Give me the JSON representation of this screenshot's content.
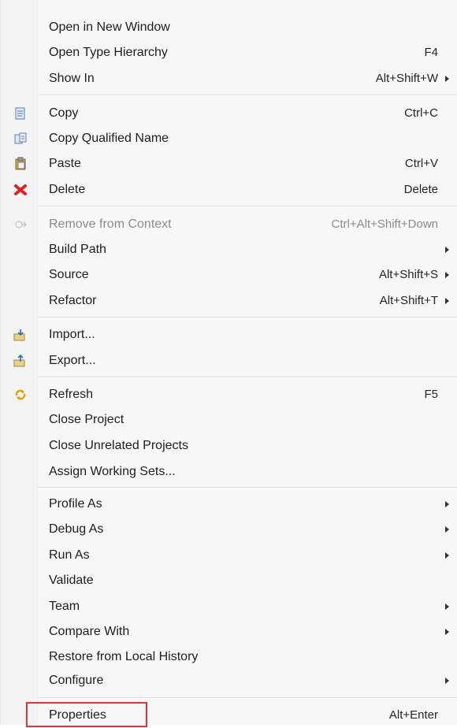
{
  "menu": {
    "groups": [
      {
        "items": [
          {
            "label": "Open in New Window",
            "shortcut": ""
          },
          {
            "label": "Open Type Hierarchy",
            "shortcut": "F4"
          },
          {
            "label": "Show In",
            "shortcut": "Alt+Shift+W",
            "submenu": true
          }
        ]
      },
      {
        "items": [
          {
            "label": "Copy",
            "shortcut": "Ctrl+C",
            "icon": "copy-icon"
          },
          {
            "label": "Copy Qualified Name",
            "shortcut": "",
            "icon": "copy-qualified-name-icon"
          },
          {
            "label": "Paste",
            "shortcut": "Ctrl+V",
            "icon": "paste-icon"
          },
          {
            "label": "Delete",
            "shortcut": "Delete",
            "icon": "delete-icon"
          }
        ]
      },
      {
        "items": [
          {
            "label": "Remove from Context",
            "shortcut": "Ctrl+Alt+Shift+Down",
            "icon": "remove-from-context-icon",
            "disabled": true
          },
          {
            "label": "Build Path",
            "shortcut": "",
            "submenu": true
          },
          {
            "label": "Source",
            "shortcut": "Alt+Shift+S",
            "submenu": true
          },
          {
            "label": "Refactor",
            "shortcut": "Alt+Shift+T",
            "submenu": true
          }
        ]
      },
      {
        "items": [
          {
            "label": "Import...",
            "shortcut": "",
            "icon": "import-icon"
          },
          {
            "label": "Export...",
            "shortcut": "",
            "icon": "export-icon"
          }
        ]
      },
      {
        "items": [
          {
            "label": "Refresh",
            "shortcut": "F5",
            "icon": "refresh-icon"
          },
          {
            "label": "Close Project",
            "shortcut": ""
          },
          {
            "label": "Close Unrelated Projects",
            "shortcut": ""
          },
          {
            "label": "Assign Working Sets...",
            "shortcut": ""
          }
        ]
      },
      {
        "items": [
          {
            "label": "Profile As",
            "shortcut": "",
            "submenu": true
          },
          {
            "label": "Debug As",
            "shortcut": "",
            "submenu": true
          },
          {
            "label": "Run As",
            "shortcut": "",
            "submenu": true
          },
          {
            "label": "Validate",
            "shortcut": ""
          },
          {
            "label": "Team",
            "shortcut": "",
            "submenu": true
          },
          {
            "label": "Compare With",
            "shortcut": "",
            "submenu": true
          },
          {
            "label": "Restore from Local History",
            "shortcut": ""
          },
          {
            "label": "Configure",
            "shortcut": "",
            "submenu": true
          }
        ]
      },
      {
        "items": [
          {
            "label": "Properties",
            "shortcut": "Alt+Enter",
            "highlighted": true
          }
        ]
      }
    ]
  },
  "colors": {
    "highlight_border": "#e0343a",
    "menu_bg": "#f7f7f7",
    "text": "#202020",
    "disabled_text": "#8c8c8c"
  }
}
